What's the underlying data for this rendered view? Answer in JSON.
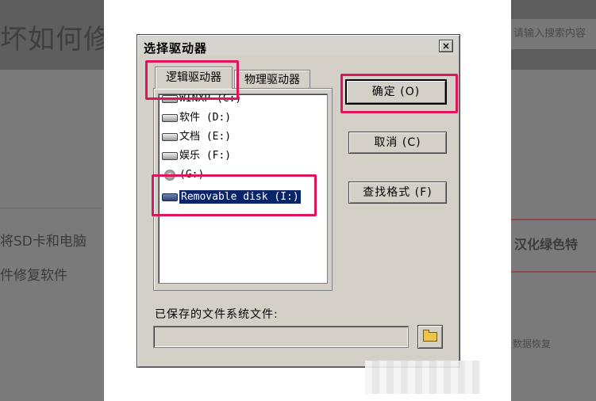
{
  "background": {
    "title": "坏如何修",
    "search_placeholder": "请输入搜索内容",
    "line1": "将SD卡和电脑",
    "line2": "件修复软件",
    "side_title": "汉化绿色特",
    "side_small": "数据恢复"
  },
  "dialog": {
    "title": "选择驱动器",
    "close_label": "×",
    "tabs": [
      {
        "label": "逻辑驱动器",
        "active": true
      },
      {
        "label": "物理驱动器",
        "active": false
      }
    ],
    "drives": [
      {
        "label": "WINXP (C:)",
        "icon": "hard-disk-icon"
      },
      {
        "label": "软件 (D:)",
        "icon": "hard-disk-icon"
      },
      {
        "label": "文档 (E:)",
        "icon": "hard-disk-icon"
      },
      {
        "label": "娱乐 (F:)",
        "icon": "hard-disk-icon"
      },
      {
        "label": "(G:)",
        "icon": "cd-drive-icon"
      },
      {
        "label": "Removable disk (I:)",
        "icon": "removable-disk-icon",
        "selected": true
      }
    ],
    "buttons": {
      "ok": "确定 (O)",
      "cancel": "取消 (C)",
      "find_format": "查找格式 (F)"
    },
    "saved_fs_label": "已保存的文件系统文件:",
    "saved_fs_value": ""
  },
  "colors": {
    "annotation": "#e0145a",
    "selection": "#0a246a",
    "dialog_face": "#d4d0c8"
  }
}
